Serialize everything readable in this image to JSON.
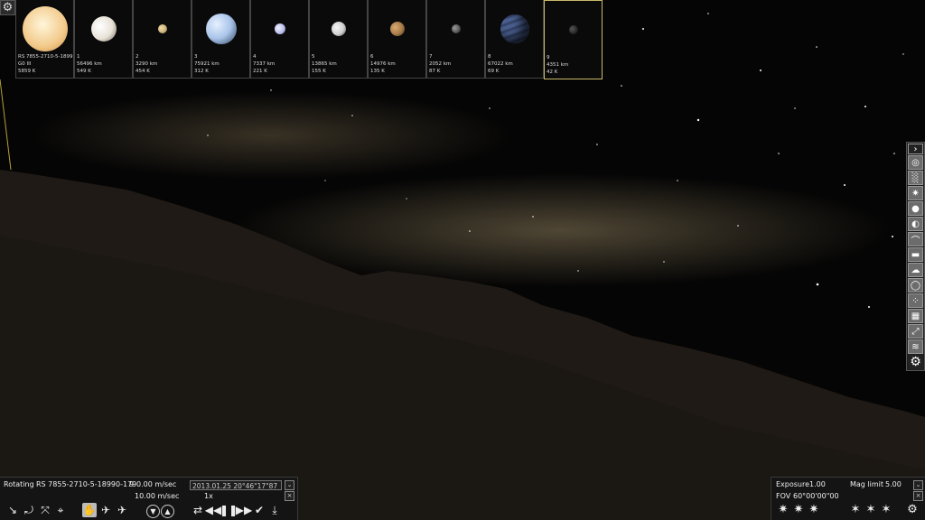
{
  "planets": [
    {
      "name": "RS 7855-2710-5-1899",
      "size": "G0 III",
      "temp": "5859 K",
      "color": "#f4d9a0",
      "selected": false
    },
    {
      "name": "1",
      "size": "56496 km",
      "temp": "549 K",
      "color": "#e8e2d6",
      "selected": false
    },
    {
      "name": "2",
      "size": "3290 km",
      "temp": "454 K",
      "color": "#c9b07a",
      "selected": false
    },
    {
      "name": "3",
      "size": "75921 km",
      "temp": "312 K",
      "color": "#a9c4e8",
      "selected": false
    },
    {
      "name": "4",
      "size": "7337 km",
      "temp": "221 K",
      "color": "#b8bde8",
      "selected": false
    },
    {
      "name": "5",
      "size": "13865 km",
      "temp": "155 K",
      "color": "#cfcfcf",
      "selected": false
    },
    {
      "name": "6",
      "size": "14976 km",
      "temp": "135 K",
      "color": "#a57a4a",
      "selected": false
    },
    {
      "name": "7",
      "size": "2052 km",
      "temp": "87 K",
      "color": "#5a5a5a",
      "selected": false
    },
    {
      "name": "8",
      "size": "67022 km",
      "temp": "69 K",
      "color": "#4a5f8f",
      "selected": false
    },
    {
      "name": "9",
      "size": "4351 km",
      "temp": "42 K",
      "color": "#3a3a3a",
      "selected": true
    }
  ],
  "status": {
    "mode": "Rotating",
    "target": "RS 7855-2710-5-18990-179",
    "speed_label": "9",
    "speed": "0.00  m/sec",
    "speed2": "10.00  m/sec",
    "date": "2013.01.25  20°46\"17\"87",
    "time_rate": "1x"
  },
  "camera": {
    "exposure_label": "Exposure",
    "exposure": "1.00",
    "mag_label": "Mag limit",
    "mag": "5.00",
    "fov_label": "FOV",
    "fov": "60°00'00\"00"
  },
  "icons": {
    "settings": "gear-icon",
    "toolbar_right": [
      "galaxy-icon",
      "nebula-icon",
      "star-icon",
      "sun-icon",
      "planet-icon",
      "comet-icon",
      "asteroid-icon",
      "cloud-icon",
      "ring-icon",
      "dots-icon",
      "grid-icon",
      "expand-icon",
      "lines-icon"
    ]
  }
}
